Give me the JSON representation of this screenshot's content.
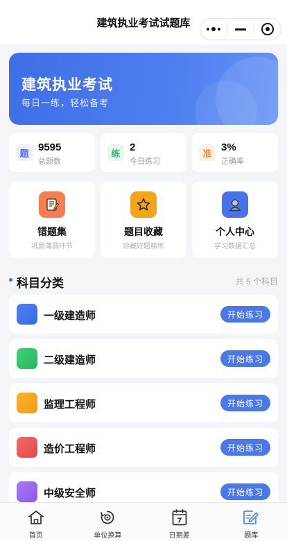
{
  "navbar": {
    "title": "建筑执业考试试题库"
  },
  "hero": {
    "title": "建筑执业考试",
    "subtitle": "每日一练，轻松备考"
  },
  "stats": [
    {
      "icon_char": "题",
      "value": "9595",
      "label": "总题数",
      "color": "#4a6cf0",
      "bg": "#eef1fd"
    },
    {
      "icon_char": "练",
      "value": "2",
      "label": "今日练习",
      "color": "#3cb96c",
      "bg": "#e8f7ee"
    },
    {
      "icon_char": "准",
      "value": "3%",
      "label": "正确率",
      "color": "#f08a2a",
      "bg": "#fdf1e6"
    }
  ],
  "features": [
    {
      "title": "错题集",
      "desc": "巩固薄弱环节",
      "icon": "notebook-icon",
      "bg": "#f47e52"
    },
    {
      "title": "题目收藏",
      "desc": "珍藏好题精练",
      "icon": "star-icon",
      "bg": "#f4a418"
    },
    {
      "title": "个人中心",
      "desc": "学习数据汇总",
      "icon": "user-icon",
      "bg": "#4a72e8"
    }
  ],
  "section": {
    "title": "科目分类",
    "count": "共 5 个科目"
  },
  "subjects": [
    {
      "name": "一级建造师",
      "button": "开始练习",
      "color": "#4a78ee"
    },
    {
      "name": "二级建造师",
      "button": "开始练习",
      "color": "#33c26a"
    },
    {
      "name": "监理工程师",
      "button": "开始练习",
      "color": "#f6a421"
    },
    {
      "name": "造价工程师",
      "button": "开始练习",
      "color": "#f05a5a"
    },
    {
      "name": "中级安全师",
      "button": "开始练习",
      "color": "#9a6af0"
    }
  ],
  "tabbar": [
    {
      "label": "首页",
      "icon": "home-icon"
    },
    {
      "label": "单位换算",
      "icon": "convert-icon"
    },
    {
      "label": "日期差",
      "icon": "calendar-icon",
      "icon_text": "7"
    },
    {
      "label": "题库",
      "icon": "edit-icon"
    }
  ]
}
